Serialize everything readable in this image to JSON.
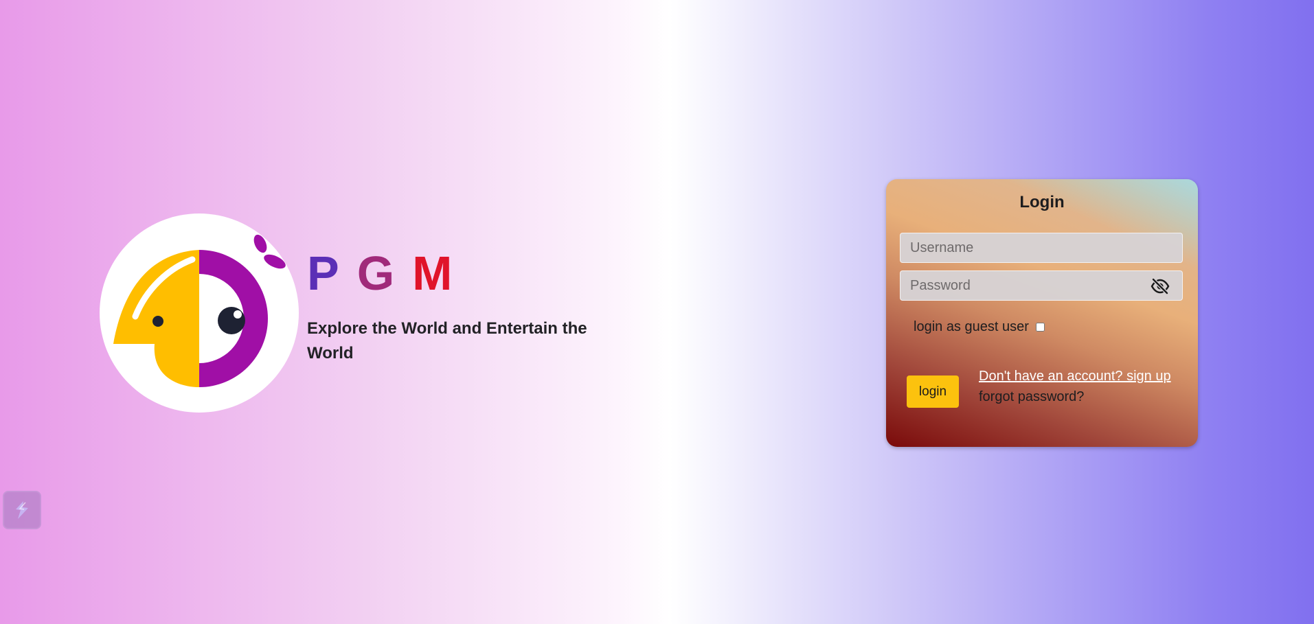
{
  "brand": {
    "letters": [
      "P",
      "G",
      "M"
    ],
    "letter_colors": [
      "#5b2fb6",
      "#a02a7a",
      "#e0142a"
    ],
    "tagline": "Explore the World and Entertain the World",
    "logo_icon": "parrot-logo-icon"
  },
  "login": {
    "title": "Login",
    "username_placeholder": "Username",
    "password_placeholder": "Password",
    "toggle_icon": "eye-off-icon",
    "guest_label": "login as guest user",
    "guest_checked": false,
    "submit_label": "login",
    "signup_link": "Don't have an account? sign up",
    "forgot_link": "forgot password?"
  },
  "floating": {
    "icon": "lightning-icon"
  },
  "colors": {
    "accent_button": "#fcc20e",
    "logo_yellow": "#ffbe00",
    "logo_purple": "#a00fa6"
  }
}
